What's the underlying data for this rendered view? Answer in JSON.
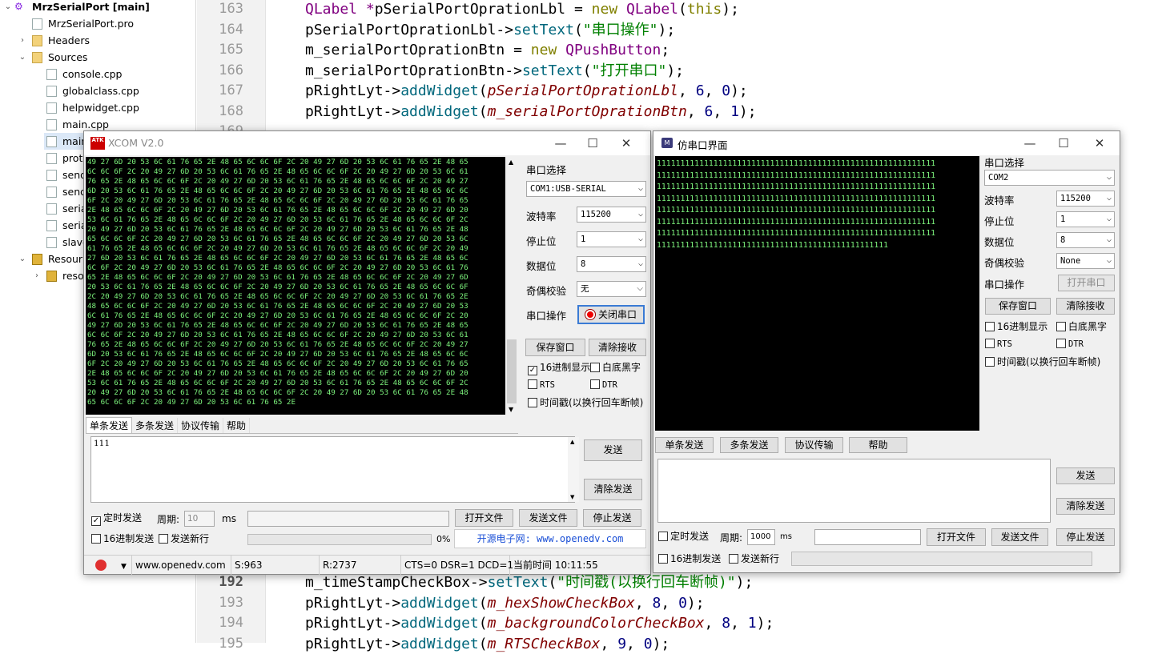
{
  "tree": {
    "items": [
      {
        "label": "MrzSerialPort [main]",
        "icon": "qt-project-icon",
        "arrow": "expanded",
        "indent": 0,
        "bold": true
      },
      {
        "label": "MrzSerialPort.pro",
        "icon": "pro-file-icon",
        "arrow": "",
        "indent": 1
      },
      {
        "label": "Headers",
        "icon": "folder-icon",
        "arrow": "collapsed",
        "indent": 1
      },
      {
        "label": "Sources",
        "icon": "folder-icon",
        "arrow": "expanded",
        "indent": 1
      },
      {
        "label": "console.cpp",
        "icon": "cpp-file-icon",
        "arrow": "",
        "indent": 2
      },
      {
        "label": "globalclass.cpp",
        "icon": "cpp-file-icon",
        "arrow": "",
        "indent": 2
      },
      {
        "label": "helpwidget.cpp",
        "icon": "cpp-file-icon",
        "arrow": "",
        "indent": 2
      },
      {
        "label": "main.cpp",
        "icon": "cpp-file-icon",
        "arrow": "",
        "indent": 2
      },
      {
        "label": "main",
        "icon": "cpp-file-icon",
        "arrow": "",
        "indent": 2,
        "selected": true
      },
      {
        "label": "prot",
        "icon": "cpp-file-icon",
        "arrow": "",
        "indent": 2
      },
      {
        "label": "send",
        "icon": "cpp-file-icon",
        "arrow": "",
        "indent": 2
      },
      {
        "label": "send",
        "icon": "cpp-file-icon",
        "arrow": "",
        "indent": 2
      },
      {
        "label": "seria",
        "icon": "cpp-file-icon",
        "arrow": "",
        "indent": 2
      },
      {
        "label": "seria",
        "icon": "cpp-file-icon",
        "arrow": "",
        "indent": 2
      },
      {
        "label": "slave",
        "icon": "cpp-file-icon",
        "arrow": "",
        "indent": 2
      },
      {
        "label": "Resour",
        "icon": "resource-lock-icon",
        "arrow": "expanded",
        "indent": 1
      },
      {
        "label": "reso",
        "icon": "resource-lock-icon",
        "arrow": "collapsed",
        "indent": 2
      }
    ]
  },
  "editor": {
    "lines_top": [
      {
        "num": "163",
        "code": [
          [
            "QLabel *",
            "ty"
          ],
          [
            "pSerialPortOprationLbl = ",
            "p"
          ],
          [
            "new ",
            "kw"
          ],
          [
            "QLabel",
            "ty"
          ],
          [
            "(",
            "p"
          ],
          [
            "this",
            "kw"
          ],
          [
            ");",
            "p"
          ]
        ]
      },
      {
        "num": "164",
        "code": [
          [
            "pSerialPortOprationLbl->",
            "p"
          ],
          [
            "setText",
            "fn"
          ],
          [
            "(",
            "p"
          ],
          [
            "\"串口操作\"",
            "st"
          ],
          [
            ");",
            "p"
          ]
        ]
      },
      {
        "num": "165",
        "code": [
          [
            "m_serialPortOprationBtn = ",
            "p"
          ],
          [
            "new ",
            "kw"
          ],
          [
            "QPushButton",
            "ty"
          ],
          [
            ";",
            "p"
          ]
        ]
      },
      {
        "num": "166",
        "code": [
          [
            "m_serialPortOprationBtn->",
            "p"
          ],
          [
            "setText",
            "fn"
          ],
          [
            "(",
            "p"
          ],
          [
            "\"打开串口\"",
            "st"
          ],
          [
            ");",
            "p"
          ]
        ]
      },
      {
        "num": "167",
        "code": [
          [
            "pRightLyt->",
            "p"
          ],
          [
            "addWidget",
            "fn"
          ],
          [
            "(",
            "p"
          ],
          [
            "pSerialPortOprationLbl",
            "it"
          ],
          [
            ", ",
            "p"
          ],
          [
            "6",
            "nm"
          ],
          [
            ", ",
            "p"
          ],
          [
            "0",
            "nm"
          ],
          [
            ");",
            "p"
          ]
        ]
      },
      {
        "num": "168",
        "code": [
          [
            "pRightLyt->",
            "p"
          ],
          [
            "addWidget",
            "fn"
          ],
          [
            "(",
            "p"
          ],
          [
            "m_serialPortOprationBtn",
            "it"
          ],
          [
            ", ",
            "p"
          ],
          [
            "6",
            "nm"
          ],
          [
            ", ",
            "p"
          ],
          [
            "1",
            "nm"
          ],
          [
            ");",
            "p"
          ]
        ]
      },
      {
        "num": "169",
        "code": []
      }
    ],
    "lines_bottom": [
      {
        "num": "192",
        "code": [
          [
            "m_timeStampCheckBox->",
            "p"
          ],
          [
            "setText",
            "fn"
          ],
          [
            "(",
            "p"
          ],
          [
            "\"时间戳(以换行回车断帧)\"",
            "st"
          ],
          [
            ");",
            "p"
          ]
        ],
        "current": true
      },
      {
        "num": "193",
        "code": [
          [
            "pRightLyt->",
            "p"
          ],
          [
            "addWidget",
            "fn"
          ],
          [
            "(",
            "p"
          ],
          [
            "m_hexShowCheckBox",
            "it"
          ],
          [
            ", ",
            "p"
          ],
          [
            "8",
            "nm"
          ],
          [
            ", ",
            "p"
          ],
          [
            "0",
            "nm"
          ],
          [
            ");",
            "p"
          ]
        ]
      },
      {
        "num": "194",
        "code": [
          [
            "pRightLyt->",
            "p"
          ],
          [
            "addWidget",
            "fn"
          ],
          [
            "(",
            "p"
          ],
          [
            "m_backgroundColorCheckBox",
            "it"
          ],
          [
            ", ",
            "p"
          ],
          [
            "8",
            "nm"
          ],
          [
            ", ",
            "p"
          ],
          [
            "1",
            "nm"
          ],
          [
            ");",
            "p"
          ]
        ]
      },
      {
        "num": "195",
        "code": [
          [
            "pRightLyt->",
            "p"
          ],
          [
            "addWidget",
            "fn"
          ],
          [
            "(",
            "p"
          ],
          [
            "m_RTSCheckBox",
            "it"
          ],
          [
            ", ",
            "p"
          ],
          [
            "9",
            "nm"
          ],
          [
            ", ",
            "p"
          ],
          [
            "0",
            "nm"
          ],
          [
            ");",
            "p"
          ]
        ]
      }
    ]
  },
  "xcom": {
    "title": "XCOM V2.0",
    "logo": "ATK",
    "hex_lines": [
      "49 27 6D 20 53 6C 61 76 65 2E 48 65 6C 6C 6F 2C 20 49 27 6D 20 53 6C 61 76 65 2E 48 65",
      "6C 6C 6F 2C 20 49 27 6D 20 53 6C 61 76 65 2E 48 65 6C 6C 6F 2C 20 49 27 6D 20 53 6C 61",
      "76 65 2E 48 65 6C 6C 6F 2C 20 49 27 6D 20 53 6C 61 76 65 2E 48 65 6C 6C 6F 2C 20 49 27",
      "6D 20 53 6C 61 76 65 2E 48 65 6C 6C 6F 2C 20 49 27 6D 20 53 6C 61 76 65 2E 48 65 6C 6C",
      "6F 2C 20 49 27 6D 20 53 6C 61 76 65 2E 48 65 6C 6C 6F 2C 20 49 27 6D 20 53 6C 61 76 65",
      "2E 48 65 6C 6C 6F 2C 20 49 27 6D 20 53 6C 61 76 65 2E 48 65 6C 6C 6F 2C 20 49 27 6D 20",
      "53 6C 61 76 65 2E 48 65 6C 6C 6F 2C 20 49 27 6D 20 53 6C 61 76 65 2E 48 65 6C 6C 6F 2C",
      "20 49 27 6D 20 53 6C 61 76 65 2E 48 65 6C 6C 6F 2C 20 49 27 6D 20 53 6C 61 76 65 2E 48",
      "65 6C 6C 6F 2C 20 49 27 6D 20 53 6C 61 76 65 2E 48 65 6C 6C 6F 2C 20 49 27 6D 20 53 6C",
      "61 76 65 2E 48 65 6C 6C 6F 2C 20 49 27 6D 20 53 6C 61 76 65 2E 48 65 6C 6C 6F 2C 20 49",
      "27 6D 20 53 6C 61 76 65 2E 48 65 6C 6C 6F 2C 20 49 27 6D 20 53 6C 61 76 65 2E 48 65 6C",
      "6C 6F 2C 20 49 27 6D 20 53 6C 61 76 65 2E 48 65 6C 6C 6F 2C 20 49 27 6D 20 53 6C 61 76",
      "65 2E 48 65 6C 6C 6F 2C 20 49 27 6D 20 53 6C 61 76 65 2E 48 65 6C 6C 6F 2C 20 49 27 6D",
      "20 53 6C 61 76 65 2E 48 65 6C 6C 6F 2C 20 49 27 6D 20 53 6C 61 76 65 2E 48 65 6C 6C 6F",
      "2C 20 49 27 6D 20 53 6C 61 76 65 2E 48 65 6C 6C 6F 2C 20 49 27 6D 20 53 6C 61 76 65 2E",
      "48 65 6C 6C 6F 2C 20 49 27 6D 20 53 6C 61 76 65 2E 48 65 6C 6C 6F 2C 20 49 27 6D 20 53",
      "6C 61 76 65 2E 48 65 6C 6C 6F 2C 20 49 27 6D 20 53 6C 61 76 65 2E 48 65 6C 6C 6F 2C 20",
      "49 27 6D 20 53 6C 61 76 65 2E 48 65 6C 6C 6F 2C 20 49 27 6D 20 53 6C 61 76 65 2E 48 65",
      "6C 6C 6F 2C 20 49 27 6D 20 53 6C 61 76 65 2E 48 65 6C 6C 6F 2C 20 49 27 6D 20 53 6C 61",
      "76 65 2E 48 65 6C 6C 6F 2C 20 49 27 6D 20 53 6C 61 76 65 2E 48 65 6C 6C 6F 2C 20 49 27",
      "6D 20 53 6C 61 76 65 2E 48 65 6C 6C 6F 2C 20 49 27 6D 20 53 6C 61 76 65 2E 48 65 6C 6C",
      "6F 2C 20 49 27 6D 20 53 6C 61 76 65 2E 48 65 6C 6C 6F 2C 20 49 27 6D 20 53 6C 61 76 65",
      "2E 48 65 6C 6C 6F 2C 20 49 27 6D 20 53 6C 61 76 65 2E 48 65 6C 6C 6F 2C 20 49 27 6D 20",
      "53 6C 61 76 65 2E 48 65 6C 6C 6F 2C 20 49 27 6D 20 53 6C 61 76 65 2E 48 65 6C 6C 6F 2C",
      "20 49 27 6D 20 53 6C 61 76 65 2E 48 65 6C 6C 6F 2C 20 49 27 6D 20 53 6C 61 76 65 2E 48",
      "65 6C 6C 6F 2C 20 49 27 6D 20 53 6C 61 76 65 2E"
    ],
    "port_label": "串口选择",
    "port_value": "COM1:USB-SERIAL",
    "baud_label": "波特率",
    "baud_value": "115200",
    "stop_label": "停止位",
    "stop_value": "1",
    "data_label": "数据位",
    "data_value": "8",
    "parity_label": "奇偶校验",
    "parity_value": "无",
    "op_label": "串口操作",
    "op_button": "关闭串口",
    "save_btn": "保存窗口",
    "clear_recv_btn": "清除接收",
    "hex_show": "16进制显示",
    "white_bg": "白底黑字",
    "rts": "RTS",
    "dtr": "DTR",
    "timestamp": "时间戳(以换行回车断帧)",
    "tabs": [
      "单条发送",
      "多条发送",
      "协议传输",
      "帮助"
    ],
    "send_text": "111",
    "send_btn": "发送",
    "clear_send_btn": "清除发送",
    "timed_send": "定时发送",
    "period_label": "周期:",
    "period_value": "10",
    "ms": "ms",
    "open_file": "打开文件",
    "send_file": "发送文件",
    "stop_send": "停止发送",
    "hex_send": "16进制发送",
    "send_newline": "发送新行",
    "progress_pct": "0%",
    "progress": 0,
    "promo": "开源电子网: www.openedv.com",
    "status": {
      "url": "www.openedv.com",
      "s": "S:963",
      "r": "R:2737",
      "lines": "CTS=0 DSR=1 DCD=1",
      "time": "当前时间 10:11:55"
    }
  },
  "fake": {
    "title": "仿串口界面",
    "logo": "M",
    "ones_lines": [
      "11111111111111111111111111111111111111111111111111111111111",
      "11111111111111111111111111111111111111111111111111111111111",
      "11111111111111111111111111111111111111111111111111111111111",
      "11111111111111111111111111111111111111111111111111111111111",
      "11111111111111111111111111111111111111111111111111111111111",
      "11111111111111111111111111111111111111111111111111111111111",
      "11111111111111111111111111111111111111111111111111111111111",
      "1111111111111111111111111111111111111111111111111"
    ],
    "port_label": "串口选择",
    "port_value": "COM2",
    "baud_label": "波特率",
    "baud_value": "115200",
    "stop_label": "停止位",
    "stop_value": "1",
    "data_label": "数据位",
    "data_value": "8",
    "parity_label": "奇偶校验",
    "parity_value": "None",
    "op_label": "串口操作",
    "op_button": "打开串口",
    "save_btn": "保存窗口",
    "clear_recv_btn": "清除接收",
    "hex_show": "16进制显示",
    "white_bg": "白底黑字",
    "rts": "RTS",
    "dtr": "DTR",
    "timestamp": "时间戳(以换行回车断帧)",
    "tabs": [
      "单条发送",
      "多条发送",
      "协议传输",
      "帮助"
    ],
    "send_btn": "发送",
    "clear_send_btn": "清除发送",
    "timed_send": "定时发送",
    "period_label": "周期:",
    "period_value": "1000",
    "ms": "ms",
    "open_file": "打开文件",
    "send_file": "发送文件",
    "stop_send": "停止发送",
    "hex_send": "16进制发送",
    "send_newline": "发送新行"
  },
  "colors": {
    "terminal_bg": "#000000",
    "terminal_fg": "#7cf27c",
    "promo": "#1a4fd6",
    "selection": "#dbe8f7"
  }
}
